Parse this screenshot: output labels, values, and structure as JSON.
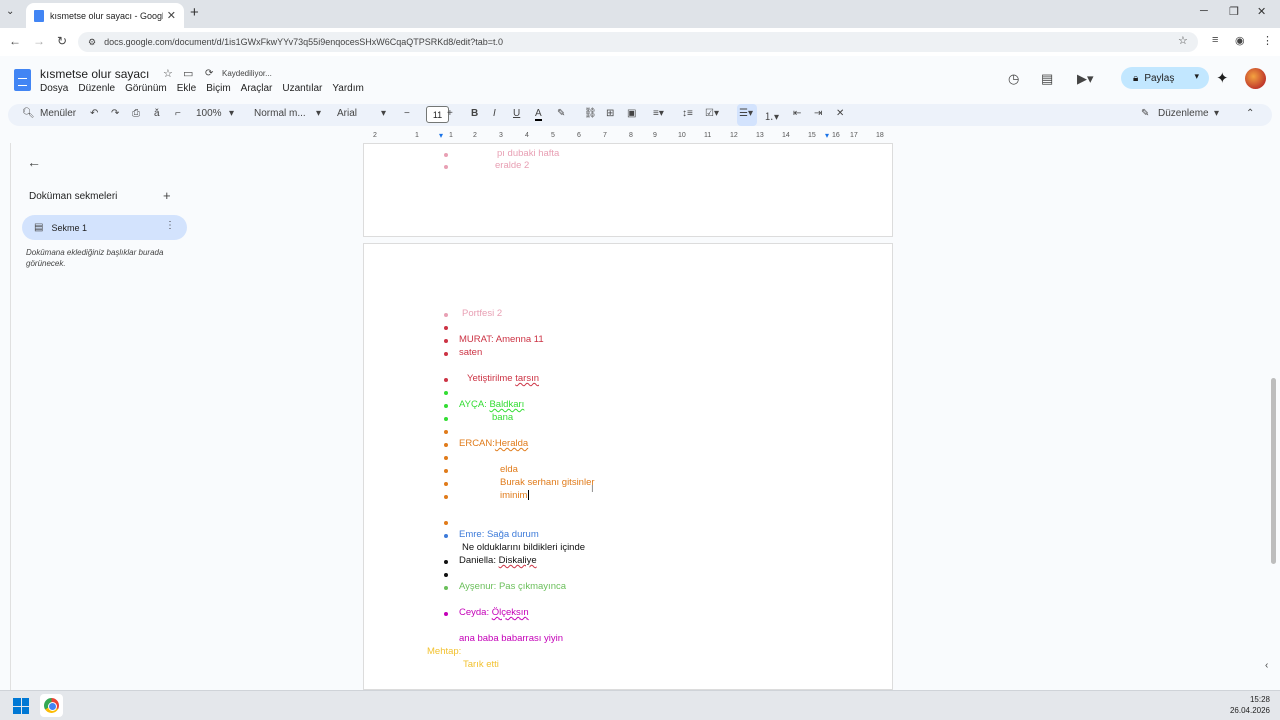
{
  "browser": {
    "tab_title": "kısmetse olur sayacı - Google D",
    "url": "docs.google.com/document/d/1is1GWxFkwYYv73q55i9enqocesSHxW6CqaQTPSRKd8/edit?tab=t.0"
  },
  "doc": {
    "title": "kısmetse olur sayacı",
    "save_status": "Kaydediliyor...",
    "menu": [
      "Dosya",
      "Düzenle",
      "Görünüm",
      "Ekle",
      "Biçim",
      "Araçlar",
      "Uzantılar",
      "Yardım"
    ],
    "share_label": "Paylaş"
  },
  "toolbar": {
    "menus_label": "Menüler",
    "zoom": "100%",
    "style": "Normal m...",
    "font": "Arial",
    "font_size": "11",
    "mode": "Düzenleme"
  },
  "ruler": [
    "2",
    "1",
    "1",
    "2",
    "3",
    "4",
    "5",
    "6",
    "7",
    "8",
    "9",
    "10",
    "11",
    "12",
    "13",
    "14",
    "15",
    "16",
    "17",
    "18"
  ],
  "sidebar": {
    "heading": "Doküman sekmeleri",
    "tab_label": "Sekme 1",
    "hint": "Dokümana eklediğiniz başlıklar burada görünecek."
  },
  "page1": {
    "lines": [
      "pı dubaki hafta",
      "eralde 2"
    ]
  },
  "page2": {
    "lines": [
      "Portfesi 2",
      "MURAT: Amenna 11",
      "saten",
      "Yetiştirilme",
      "tarsın",
      "AYÇA:",
      "Baldkarı",
      "bana",
      "ERCAN:",
      "Heralda",
      "elda",
      "Burak serhanı gitsinler",
      "iminim",
      "Emre: Sağa durum",
      "Ne olduklarını bildikleri içinde",
      "Daniella: ",
      "Diskaliye",
      "Ayşenur: Pas çıkmayınca",
      "Ceyda: ",
      "Ölçeksın",
      "ana baba babarrası yiyin",
      "Mehtap:",
      "Tarık etti"
    ]
  },
  "colors": {
    "pink": "#e8a0b4",
    "red": "#cc3344",
    "green": "#33dd33",
    "orange": "#e07b1a",
    "blue": "#3d7bd9",
    "dark": "#111111",
    "lightgreen": "#6abf5a",
    "magenta": "#c400b8",
    "yellow": "#f2c230"
  },
  "taskbar": {
    "time": "15:28",
    "date": "26.04.2026"
  }
}
